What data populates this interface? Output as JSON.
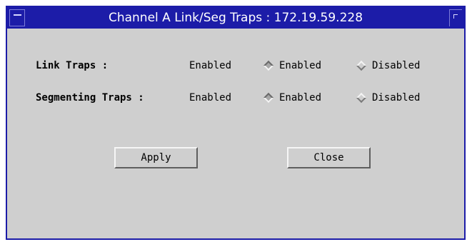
{
  "window": {
    "title": "Channel A Link/Seg Traps : 172.19.59.228"
  },
  "rows": [
    {
      "label": "Link Traps :",
      "current_value": "Enabled",
      "options": [
        {
          "label": "Enabled",
          "selected": true
        },
        {
          "label": "Disabled",
          "selected": false
        }
      ]
    },
    {
      "label": "Segmenting Traps :",
      "current_value": "Enabled",
      "options": [
        {
          "label": "Enabled",
          "selected": true
        },
        {
          "label": "Disabled",
          "selected": false
        }
      ]
    }
  ],
  "buttons": {
    "apply": "Apply",
    "close": "Close"
  }
}
